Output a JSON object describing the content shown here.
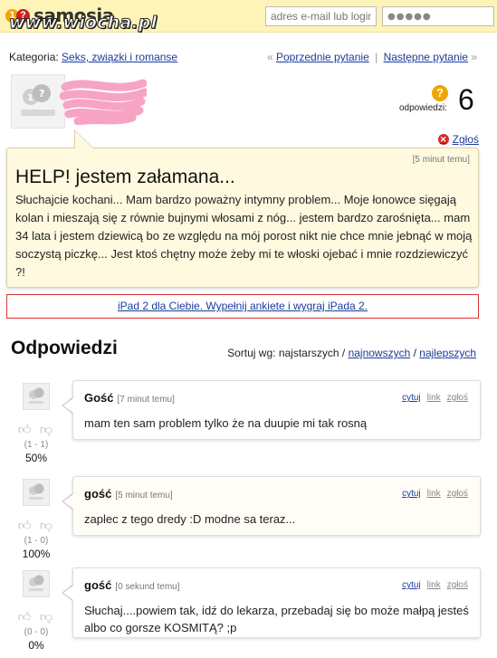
{
  "header": {
    "logo_text": "samosia",
    "logo_badge_1": "1",
    "logo_badge_2": "?",
    "watermark": "www.wiocha.pl",
    "email_placeholder": "adres e-mail lub login",
    "password_value": "●●●●●"
  },
  "category": {
    "label": "Kategoria:",
    "value": "Seks, związki i romanse"
  },
  "question_nav": {
    "prev_arrow": "«",
    "prev": "Poprzednie pytanie",
    "separator": "|",
    "next": "Następne pytanie",
    "next_arrow": "»"
  },
  "question": {
    "answers_label": "odpowiedzi:",
    "answers_count": "6",
    "report_label": "Zgłoś",
    "time": "[5 minut temu]",
    "title": "HELP! jestem załamana...",
    "body": "Słuchajcie kochani... Mam bardzo poważny intymny problem... Moje łonowce sięgają kolan i mieszają się z równie bujnymi włosami z nóg... jestem bardzo zarośnięta... mam 34 lata i jestem dziewicą bo ze względu na mój porost nikt nie chce mnie jebnąć w moją soczystą piczkę... Jest ktoś chętny może żeby mi te włoski ojebać i mnie rozdziewiczyć ?!"
  },
  "ad": {
    "text": "iPad 2 dla Ciebie. Wypełnij ankiete i wygraj iPada 2."
  },
  "answers_section": {
    "title": "Odpowiedzi",
    "sort_label": "Sortuj wg:",
    "sort_active": "najstarszych",
    "sort_newest": "najnowszych",
    "sort_best": "najlepszych",
    "sep": "/"
  },
  "answers": [
    {
      "author": "Gość",
      "time": "[7 minut temu]",
      "text": "mam ten sam problem tylko że na duupie mi tak rosną",
      "votes": "(1 - 1)",
      "percent": "50%",
      "quote": "cytuj",
      "link": "link",
      "report": "zgłoś"
    },
    {
      "author": "gość",
      "time": "[5 minut temu]",
      "text": "zaplec z tego dredy :D modne sa teraz...",
      "votes": "(1 - 0)",
      "percent": "100%",
      "quote": "cytuj",
      "link": "link",
      "report": "zgłoś"
    },
    {
      "author": "gość",
      "time": "[0 sekund temu]",
      "text": "Słuchaj....powiem tak, idź do lekarza, przebadaj się bo może małpą jesteś albo co gorsze KOSMITĄ? ;p",
      "votes": "(0 - 0)",
      "percent": "0%",
      "quote": "cytuj",
      "link": "link",
      "report": "zgłoś"
    }
  ],
  "icons": {
    "avatar": "samosia-avatar-icon",
    "question": "question-mark-icon",
    "report": "report-x-icon",
    "thumb_up": "thumb-up-icon",
    "thumb_down": "thumb-down-icon"
  },
  "colors": {
    "header_bg": "#fff4b8",
    "bubble_bg": "#fffadf",
    "link": "#1a3c9b",
    "ad_border": "#dd3333",
    "accent_orange": "#f0a500",
    "report_red": "#d42b2b"
  }
}
